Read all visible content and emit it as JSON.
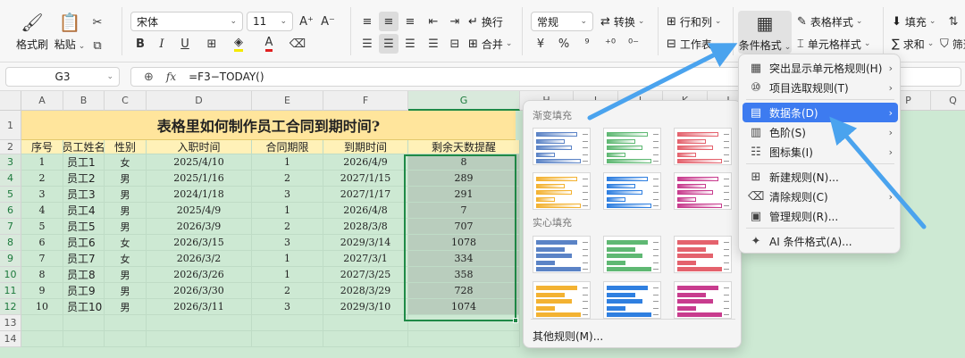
{
  "ribbon": {
    "format_painter": "格式刷",
    "paste": "粘贴",
    "font_name": "宋体",
    "font_size": "11",
    "bold": "B",
    "italic": "I",
    "underline": "U",
    "wrap": "换行",
    "merge": "合并",
    "number_format": "常规",
    "convert": "转换",
    "rows_cols": "行和列",
    "worksheet": "工作表",
    "cond_format": "条件格式",
    "table_style": "表格样式",
    "cell_style": "单元格样式",
    "fill": "填充",
    "sum": "求和",
    "filter": "筛选"
  },
  "formula_bar": {
    "name_box": "G3",
    "fx": "fx",
    "formula": "=F3−TODAY()"
  },
  "columns": [
    "A",
    "B",
    "C",
    "D",
    "E",
    "F",
    "G",
    "H",
    "I",
    "J",
    "K",
    "L",
    "M",
    "N",
    "O",
    "P",
    "Q",
    "R"
  ],
  "rows": [
    "1",
    "2",
    "3",
    "4",
    "5",
    "6",
    "7",
    "8",
    "9",
    "10",
    "11",
    "12",
    "13",
    "14"
  ],
  "sheet": {
    "title": "表格里如何制作员工合同到期时间?",
    "headers": [
      "序号",
      "员工姓名",
      "性别",
      "入职时间",
      "合同期限",
      "到期时间",
      "剩余天数提醒"
    ],
    "data": [
      [
        "1",
        "员工1",
        "女",
        "2025/4/10",
        "1",
        "2026/4/9",
        "8"
      ],
      [
        "2",
        "员工2",
        "男",
        "2025/1/16",
        "2",
        "2027/1/15",
        "289"
      ],
      [
        "3",
        "员工3",
        "男",
        "2024/1/18",
        "3",
        "2027/1/17",
        "291"
      ],
      [
        "4",
        "员工4",
        "男",
        "2025/4/9",
        "1",
        "2026/4/8",
        "7"
      ],
      [
        "5",
        "员工5",
        "男",
        "2026/3/9",
        "2",
        "2028/3/8",
        "707"
      ],
      [
        "6",
        "员工6",
        "女",
        "2026/3/15",
        "3",
        "2029/3/14",
        "1078"
      ],
      [
        "7",
        "员工7",
        "女",
        "2026/3/2",
        "1",
        "2027/3/1",
        "334"
      ],
      [
        "8",
        "员工8",
        "男",
        "2026/3/26",
        "1",
        "2027/3/25",
        "358"
      ],
      [
        "9",
        "员工9",
        "男",
        "2026/3/30",
        "2",
        "2028/3/29",
        "728"
      ],
      [
        "10",
        "员工10",
        "男",
        "2026/3/11",
        "3",
        "2029/3/10",
        "1074"
      ]
    ]
  },
  "gallery": {
    "gradient_label": "渐变填充",
    "solid_label": "实心填充",
    "more": "其他规则(M)...",
    "colors": [
      "#5b83c6",
      "#5fb873",
      "#e4626d",
      "#f3b232",
      "#2f7fe0",
      "#c83c8e"
    ]
  },
  "menu": {
    "items": [
      {
        "icon": "highlight-cells-icon",
        "glyph": "▦",
        "label": "突出显示单元格规则(H)",
        "submenu": true
      },
      {
        "icon": "top-bottom-icon",
        "glyph": "⑩",
        "label": "项目选取规则(T)",
        "submenu": true
      },
      {
        "icon": "data-bars-icon",
        "glyph": "▤",
        "label": "数据条(D)",
        "submenu": true
      },
      {
        "icon": "color-scale-icon",
        "glyph": "▥",
        "label": "色阶(S)",
        "submenu": true
      },
      {
        "icon": "icon-sets-icon",
        "glyph": "☷",
        "label": "图标集(I)",
        "submenu": true
      },
      {
        "icon": "new-rule-icon",
        "glyph": "⊞",
        "label": "新建规则(N)...",
        "submenu": false
      },
      {
        "icon": "clear-rules-icon",
        "glyph": "⌫",
        "label": "清除规则(C)",
        "submenu": true
      },
      {
        "icon": "manage-rules-icon",
        "glyph": "▣",
        "label": "管理规则(R)...",
        "submenu": false
      },
      {
        "icon": "ai-format-icon",
        "glyph": "✦",
        "label": "AI 条件格式(A)...",
        "submenu": false
      }
    ]
  },
  "colors": {
    "sheet_bg": "#cde9d3",
    "header_bg": "#fff1b8",
    "title_bg": "#ffe59c",
    "selection": "#1f8a47",
    "menu_highlight": "#3d7bf0",
    "arrow": "#4aa3ee"
  }
}
